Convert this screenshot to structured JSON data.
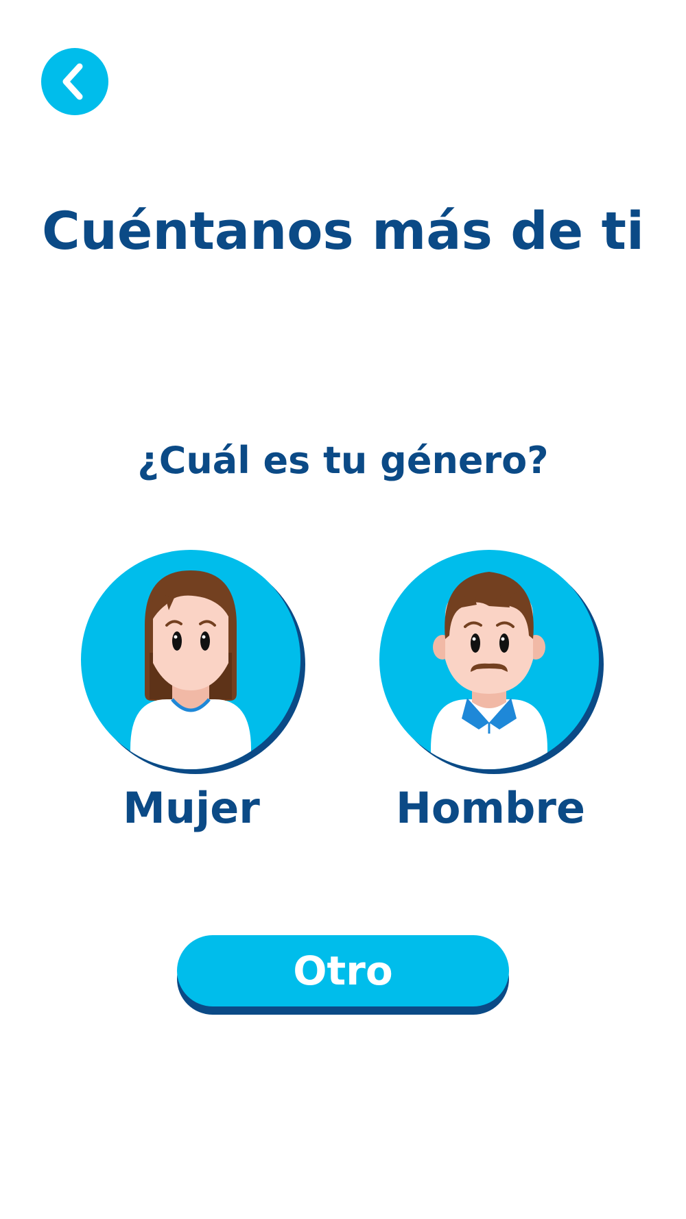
{
  "header": {
    "back_icon": "chevron-left-icon"
  },
  "title": "Cuéntanos más de ti",
  "question": "¿Cuál es tu género?",
  "options": [
    {
      "label": "Mujer",
      "icon": "woman-avatar-icon"
    },
    {
      "label": "Hombre",
      "icon": "man-avatar-icon"
    }
  ],
  "other_button": {
    "label": "Otro"
  },
  "colors": {
    "accent": "#00BDEB",
    "text": "#0B4A86",
    "shadow": "#0B4A86",
    "hair": "#734020",
    "skin": "#FAD3C5"
  }
}
